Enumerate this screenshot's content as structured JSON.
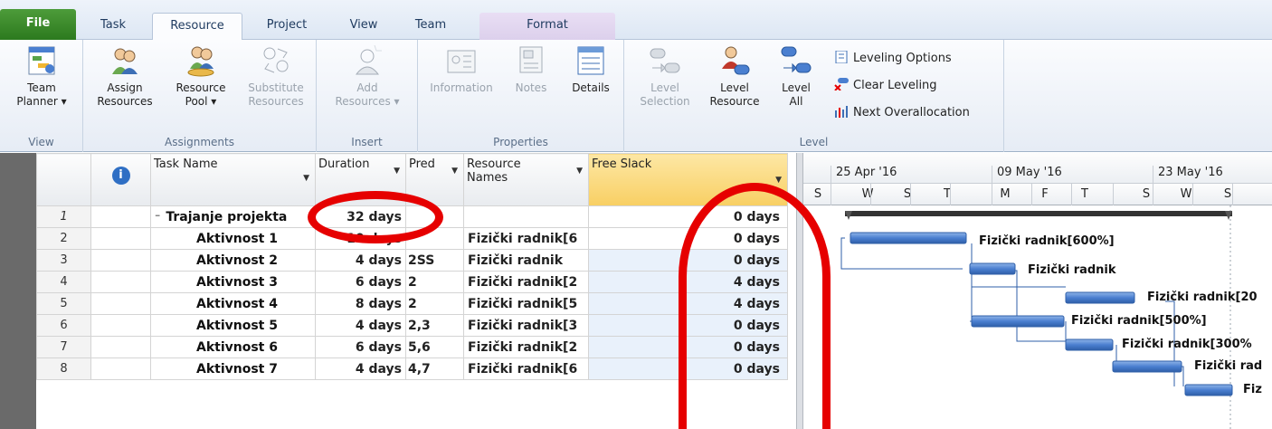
{
  "tabs": {
    "file": "File",
    "task": "Task",
    "resource": "Resource",
    "project": "Project",
    "view": "View",
    "team": "Team",
    "format": "Format"
  },
  "ribbon": {
    "view_group": {
      "label": "View",
      "team_planner": "Team Planner",
      "team_planner_line1": "Team",
      "team_planner_line2": "Planner ▾"
    },
    "assignments_group": {
      "label": "Assignments",
      "assign_l1": "Assign",
      "assign_l2": "Resources",
      "pool_l1": "Resource",
      "pool_l2": "Pool ▾",
      "substitute_l1": "Substitute",
      "substitute_l2": "Resources"
    },
    "insert_group": {
      "label": "Insert",
      "add_l1": "Add",
      "add_l2": "Resources ▾"
    },
    "properties_group": {
      "label": "Properties",
      "information": "Information",
      "notes": "Notes",
      "details": "Details"
    },
    "level_group": {
      "label": "Level",
      "sel_l1": "Level",
      "sel_l2": "Selection",
      "res_l1": "Level",
      "res_l2": "Resource",
      "all_l1": "Level",
      "all_l2": "All",
      "leveling_options": "Leveling Options",
      "clear_leveling": "Clear Leveling",
      "next_overallocation": "Next Overallocation"
    }
  },
  "grid": {
    "headers": {
      "info": "i",
      "task_name": "Task Name",
      "duration": "Duration",
      "pred": "Pred",
      "resource_names_l1": "Resource",
      "resource_names_l2": "Names",
      "free_slack": "Free Slack"
    },
    "rows": [
      {
        "id": "1",
        "name": "Trajanje projekta",
        "duration": "32 days",
        "pred": "",
        "resources": "",
        "slack": "0 days"
      },
      {
        "id": "2",
        "name": "Aktivnost 1",
        "duration": "10 days",
        "pred": "",
        "resources": "Fizički radnik[6",
        "slack": "0 days"
      },
      {
        "id": "3",
        "name": "Aktivnost 2",
        "duration": "4 days",
        "pred": "2SS",
        "resources": "Fizički radnik",
        "slack": "0 days"
      },
      {
        "id": "4",
        "name": "Aktivnost 3",
        "duration": "6 days",
        "pred": "2",
        "resources": "Fizički radnik[2",
        "slack": "4 days"
      },
      {
        "id": "5",
        "name": "Aktivnost 4",
        "duration": "8 days",
        "pred": "2",
        "resources": "Fizički radnik[5",
        "slack": "4 days"
      },
      {
        "id": "6",
        "name": "Aktivnost 5",
        "duration": "4 days",
        "pred": "2,3",
        "resources": "Fizički radnik[3",
        "slack": "0 days"
      },
      {
        "id": "7",
        "name": "Aktivnost 6",
        "duration": "6 days",
        "pred": "5,6",
        "resources": "Fizički radnik[2",
        "slack": "0 days"
      },
      {
        "id": "8",
        "name": "Aktivnost 7",
        "duration": "4 days",
        "pred": "4,7",
        "resources": "Fizički radnik[6",
        "slack": "0 days"
      }
    ]
  },
  "gantt": {
    "weeks": [
      "25 Apr '16",
      "09 May '16",
      "23 May '16"
    ],
    "days": [
      "S",
      "W",
      "S",
      "T",
      "M",
      "F",
      "T",
      "S",
      "W",
      "S"
    ],
    "bar_labels": [
      "Fizički radnik[600%]",
      "Fizički radnik",
      "Fizički radnik[20",
      "Fizički radnik[500%]",
      "Fizički radnik[300%",
      "Fizički rad",
      "Fiz"
    ]
  },
  "colors": {
    "bar_fill": "#4a7fd0",
    "annotation_red": "#e60000",
    "selected_header": "#f8cf63"
  }
}
